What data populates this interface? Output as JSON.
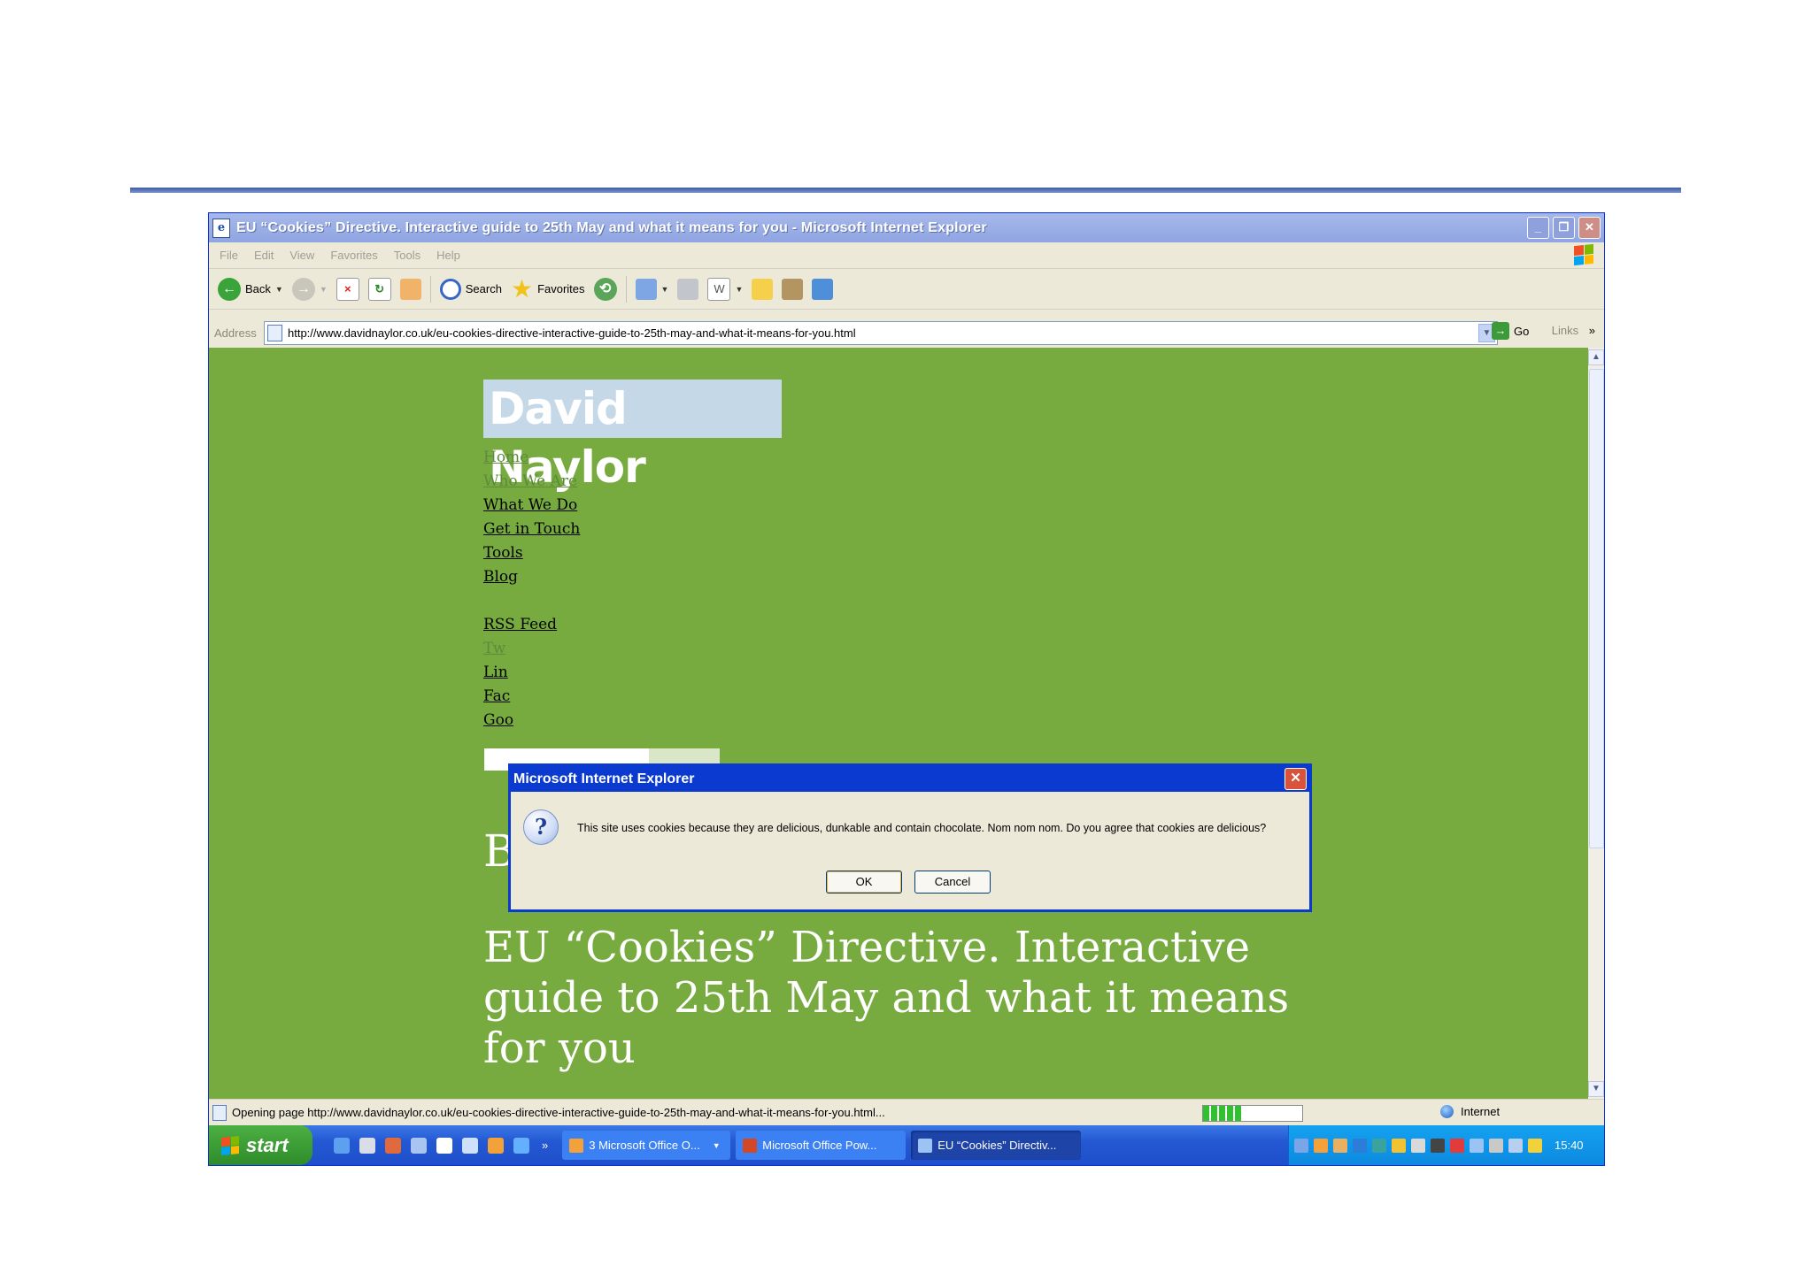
{
  "window": {
    "title": "EU “Cookies” Directive. Interactive guide to 25th May and what it means for you - Microsoft Internet Explorer",
    "minimize_glyph": "_",
    "restore_glyph": "❐",
    "close_glyph": "✕"
  },
  "menubar": {
    "items": [
      "File",
      "Edit",
      "View",
      "Favorites",
      "Tools",
      "Help"
    ]
  },
  "toolbar": {
    "back_label": "Back",
    "search_label": "Search",
    "favorites_label": "Favorites"
  },
  "addressbar": {
    "label": "Address",
    "url": "http://www.davidnaylor.co.uk/eu-cookies-directive-interactive-guide-to-25th-may-and-what-it-means-for-you.html",
    "go_label": "Go",
    "links_label": "Links",
    "links_more": "»"
  },
  "page": {
    "logo_text": "David Naylor",
    "nav": [
      "Home",
      "Who We Are",
      "What We Do",
      "Get in Touch",
      "Tools",
      "Blog"
    ],
    "social": [
      "RSS Feed",
      "Tw",
      "Lin",
      "Fac",
      "Goo"
    ],
    "blog_heading": "Blog",
    "post_title": "EU “Cookies” Directive. Interactive guide to 25th May and what it means for you"
  },
  "dialog": {
    "title": "Microsoft Internet Explorer",
    "message": "This site uses cookies because they are delicious, dunkable and contain chocolate. Nom nom nom. Do you agree that cookies are delicious?",
    "ok_label": "OK",
    "cancel_label": "Cancel",
    "icon": "question-icon"
  },
  "statusbar": {
    "text": "Opening page http://www.davidnaylor.co.uk/eu-cookies-directive-interactive-guide-to-25th-may-and-what-it-means-for-you.html...",
    "progress_fraction": 0.4,
    "zone": "Internet"
  },
  "taskbar": {
    "start_label": "start",
    "tasks": [
      "3 Microsoft Office O...",
      "Microsoft Office Pow...",
      "EU “Cookies” Directiv..."
    ],
    "chevron": "»",
    "clock": "15:40"
  },
  "colors": {
    "page_background": "#77ab40",
    "xp_blue": "#0a3ad0",
    "start_green": "#3ea037"
  }
}
